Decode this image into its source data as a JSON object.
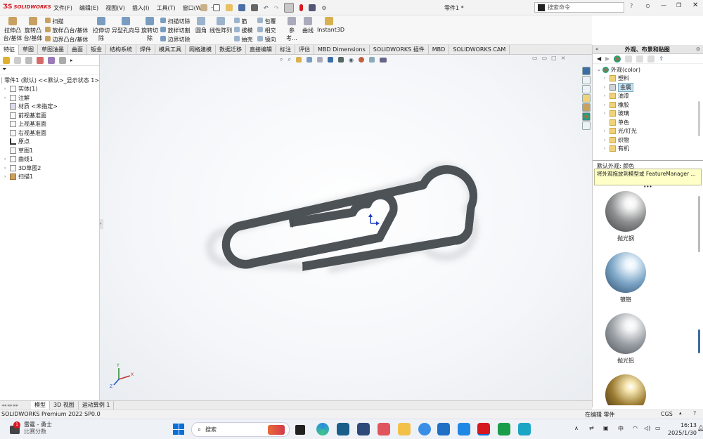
{
  "titlebar": {
    "logo": "SOLIDWORKS",
    "menus": [
      "文件(F)",
      "编辑(E)",
      "视图(V)",
      "插入(I)",
      "工具(T)",
      "窗口(W)"
    ],
    "doc_title": "零件1 *",
    "search_placeholder": "搜索命令"
  },
  "ribbon": {
    "group1": [
      {
        "label1": "拉伸凸",
        "label2": "台/基体"
      },
      {
        "label1": "旋转凸",
        "label2": "台/基体"
      }
    ],
    "group1_small": [
      "扫描",
      "放样凸台/基体",
      "边界凸台/基体"
    ],
    "group2": [
      {
        "label1": "拉伸切",
        "label2": "除"
      },
      {
        "label1": "异型孔向导",
        "label2": ""
      },
      {
        "label1": "旋转切",
        "label2": "除"
      }
    ],
    "group2_small": [
      "扫描切除",
      "放样切割",
      "边界切除"
    ],
    "group3": [
      "圆角",
      "线性阵列"
    ],
    "group3_small": [
      "筋",
      "拔模",
      "抽壳"
    ],
    "group4_small": [
      "包覆",
      "相交",
      "镜向"
    ],
    "group5": [
      "参考...",
      "曲线",
      "Instant3D"
    ]
  },
  "tabs": [
    "特征",
    "草图",
    "草图油墨",
    "曲面",
    "钣金",
    "结构系统",
    "焊件",
    "模具工具",
    "网格建模",
    "数据迁移",
    "直接编辑",
    "标注",
    "评估",
    "MBD Dimensions",
    "SOLIDWORKS 插件",
    "MBD",
    "SOLIDWORKS CAM"
  ],
  "tree": {
    "root": "零件1 (默认) <<默认>_显示状态 1>",
    "items": [
      {
        "label": "实体(1)",
        "arrow": "›"
      },
      {
        "label": "注解",
        "arrow": "›"
      },
      {
        "label": "材质 <未指定>",
        "arrow": ""
      },
      {
        "label": "前视基准面",
        "arrow": ""
      },
      {
        "label": "上视基准面",
        "arrow": ""
      },
      {
        "label": "右视基准面",
        "arrow": ""
      },
      {
        "label": "原点",
        "arrow": ""
      },
      {
        "label": "草图1",
        "arrow": ""
      },
      {
        "label": "曲线1",
        "arrow": "›"
      },
      {
        "label": "3D草图2",
        "arrow": "›"
      },
      {
        "label": "扫描1",
        "arrow": "›"
      }
    ]
  },
  "bottom_tabs": [
    "模型",
    "3D 视图",
    "运动算例 1"
  ],
  "status": {
    "left": "SOLIDWORKS Premium 2022 SP0.0",
    "mode": "在编辑 零件",
    "units": "CGS"
  },
  "right": {
    "title": "外观、布景和贴图",
    "items": [
      "外观(color)",
      "塑料",
      "金属",
      "油漆",
      "橡胶",
      "玻璃",
      "单色",
      "光/灯光",
      "织物",
      "有机"
    ],
    "default_label": "默认外观: 颜色",
    "hint": "将外观拖放到模型或 FeatureManager ...",
    "swatches": [
      {
        "label": "抛光钢",
        "c1": "#f4f4f4",
        "c2": "#8d8f90",
        "c3": "#3c3e40"
      },
      {
        "label": "镀铬",
        "c1": "#e8f3fb",
        "c2": "#7ea6c7",
        "c3": "#284a6a"
      },
      {
        "label": "抛光铝",
        "c1": "#f2f3f4",
        "c2": "#9aa0a5",
        "c3": "#4a4f55"
      },
      {
        "label": "",
        "c1": "#f5e5b0",
        "c2": "#9a7a30",
        "c3": "#3a2a10"
      }
    ]
  },
  "taskbar": {
    "weather_temp": "1",
    "weather_title": "雷霆 - 勇士",
    "weather_sub": "比赛分数",
    "search": "搜索",
    "ime": "中",
    "time": "16:13",
    "date": "2025/1/30"
  },
  "colors": {
    "accent": "#d7171f",
    "selection": "#cce4f7",
    "tube": "#6f7579"
  }
}
